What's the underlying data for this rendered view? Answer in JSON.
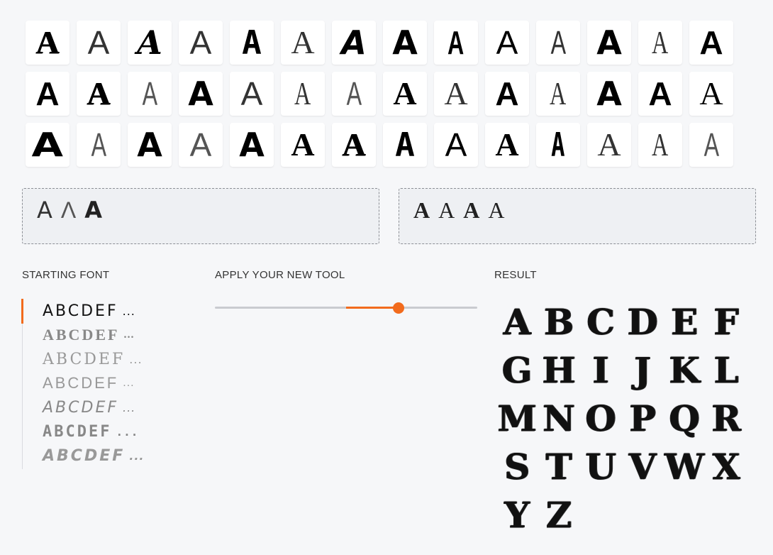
{
  "glyph_grid": {
    "letter": "A",
    "tiles": [
      {
        "style": "g-serif w-bold s-rough"
      },
      {
        "style": "g-sans w-thin"
      },
      {
        "style": "g-dserif w-bold s-ital"
      },
      {
        "style": "g-sans w-thin"
      },
      {
        "style": "g-mono w-bold"
      },
      {
        "style": "g-serif w-thin"
      },
      {
        "style": "g-dsans w-bold s-ital"
      },
      {
        "style": "g-dsans w-bold"
      },
      {
        "style": "g-sans w-bold s-narrow"
      },
      {
        "style": "g-sans"
      },
      {
        "style": "g-sans w-thin s-narrow"
      },
      {
        "style": "g-dsans w-bold"
      },
      {
        "style": "g-serif w-thin s-narrow"
      },
      {
        "style": "g-sans w-bold"
      },
      {
        "style": "g-sans w-bold"
      },
      {
        "style": "g-serif w-bold s-rough"
      },
      {
        "style": "g-sans w-light s-narrow"
      },
      {
        "style": "g-dsans w-bold"
      },
      {
        "style": "g-sans w-thin"
      },
      {
        "style": "g-serif w-thin s-narrow"
      },
      {
        "style": "g-sans w-light s-narrow"
      },
      {
        "style": "g-serif w-bold"
      },
      {
        "style": "g-serif w-thin"
      },
      {
        "style": "g-sans w-bold"
      },
      {
        "style": "g-serif w-thin s-narrow"
      },
      {
        "style": "g-dsans w-bold"
      },
      {
        "style": "g-sans w-bold"
      },
      {
        "style": "g-serif"
      },
      {
        "style": "g-dsans w-bold s-wide"
      },
      {
        "style": "g-sans w-light s-narrow"
      },
      {
        "style": "g-dsans w-bold"
      },
      {
        "style": "g-sans w-light"
      },
      {
        "style": "g-dsans w-bold"
      },
      {
        "style": "g-serif w-bold"
      },
      {
        "style": "g-serif w-bold s-rough"
      },
      {
        "style": "g-mono w-bold"
      },
      {
        "style": "g-sans"
      },
      {
        "style": "g-serif w-bold"
      },
      {
        "style": "g-mono w-bold s-narrow"
      },
      {
        "style": "g-serif w-thin"
      },
      {
        "style": "g-serif w-thin s-narrow"
      },
      {
        "style": "g-sans w-light s-narrow"
      }
    ]
  },
  "drop_zones": [
    {
      "letters": [
        "A",
        "Λ",
        "A"
      ],
      "styles": [
        "g-dsans w-thin",
        "g-sans w-light",
        "g-dsans w-bold"
      ]
    },
    {
      "letters": [
        "A",
        "A",
        "A",
        "A"
      ],
      "styles": [
        "g-serif w-bold",
        "g-serif",
        "g-serif w-bold",
        "g-serif"
      ]
    }
  ],
  "starting_font": {
    "label": "STARTING FONT",
    "selected_index": 0,
    "samples": [
      "ABCDEF",
      "ABCDEF",
      "ABCDEF",
      "ABCDEF",
      "ABCDEF",
      "ABCDEF",
      "ABCDEF"
    ],
    "ellipsis": "...",
    "accent": "#f26b1d"
  },
  "tool": {
    "label": "APPLY YOUR NEW TOOL",
    "slider_value": 0.7,
    "accent": "#f26b1d"
  },
  "result": {
    "label": "RESULT",
    "letters": [
      "A",
      "B",
      "C",
      "D",
      "E",
      "F",
      "G",
      "H",
      "I",
      "J",
      "K",
      "L",
      "M",
      "N",
      "O",
      "P",
      "Q",
      "R",
      "S",
      "T",
      "U",
      "V",
      "W",
      "X",
      "Y",
      "Z"
    ]
  }
}
